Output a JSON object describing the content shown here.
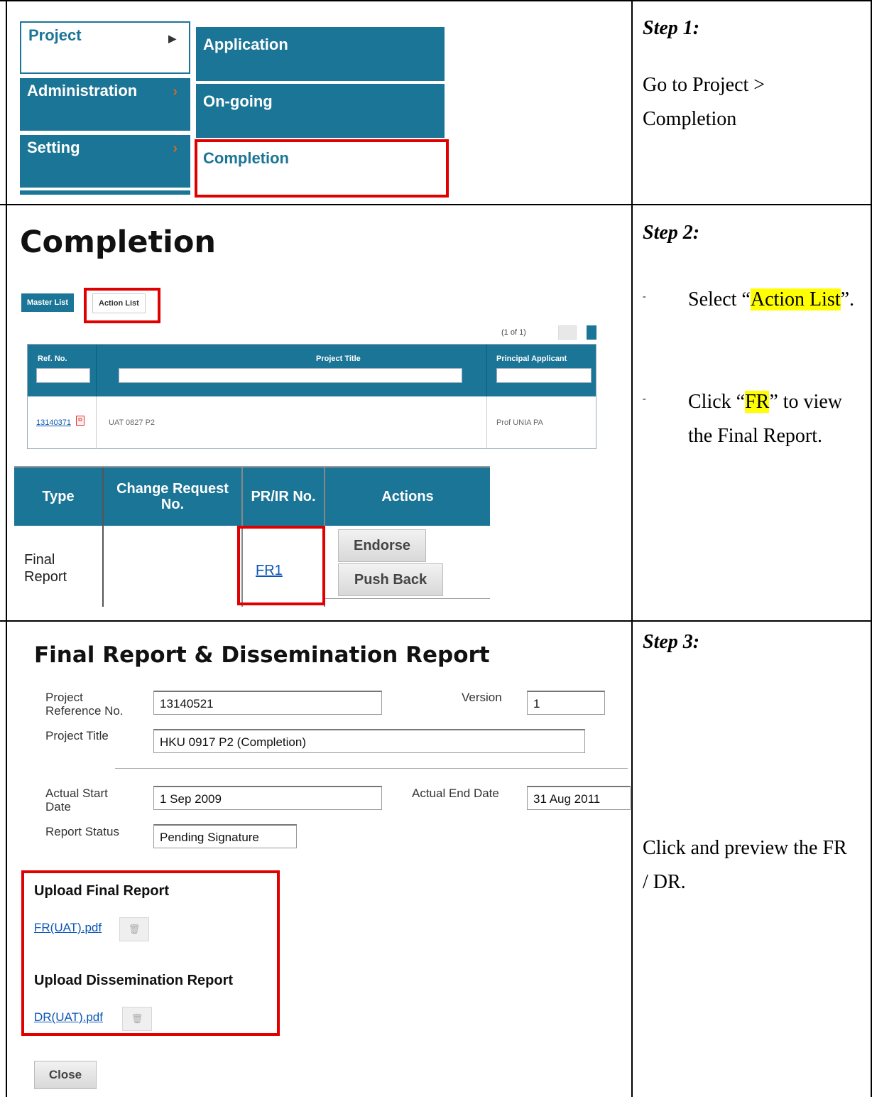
{
  "section1": {
    "menu": [
      {
        "label": "Project",
        "arrow": "▶"
      },
      {
        "label": "Administration",
        "arrow": "›"
      },
      {
        "label": "Setting",
        "arrow": "›"
      }
    ],
    "submenu": [
      "Application",
      "On-going",
      "Completion"
    ],
    "step_title": "Step 1:",
    "instruction": "Go to Project > Completion"
  },
  "section2": {
    "page_title": "Completion",
    "tabs": {
      "master": "Master List",
      "action": "Action List"
    },
    "pagination": "(1 of 1)",
    "list_headers": [
      "Ref. No.",
      "Project Title",
      "Principal Applicant"
    ],
    "list_row": {
      "ref": "13140371",
      "title": "UAT 0827 P2",
      "applicant": "Prof UNIA PA"
    },
    "action_headers": [
      "Type",
      "Change Request No.",
      "PR/IR No.",
      "Actions"
    ],
    "action_row": {
      "type": "Final Report",
      "change_request": "",
      "pr_ir": "FR1"
    },
    "buttons": {
      "endorse": "Endorse",
      "push_back": "Push Back"
    },
    "step_title": "Step 2:",
    "bullet1": {
      "prefix": "Select “",
      "highlight": "Action List",
      "suffix": "”."
    },
    "bullet2": {
      "prefix": "Click “",
      "highlight": "FR",
      "suffix": "” to view the Final Report."
    },
    "bullet_marker": "-"
  },
  "section3": {
    "page_title": "Final Report & Dissemination Report",
    "labels": {
      "ref": "Project Reference No.",
      "version": "Version",
      "title": "Project Title",
      "start": "Actual Start Date",
      "end": "Actual End Date",
      "status": "Report Status"
    },
    "values": {
      "ref": "13140521",
      "version": "1",
      "title": "HKU 0917 P2 (Completion)",
      "start": "1 Sep 2009",
      "end": "31 Aug 2011",
      "status": "Pending Signature"
    },
    "upload_final": "Upload Final Report",
    "final_file": "FR(UAT).pdf",
    "upload_dissemination": "Upload Dissemination Report",
    "dissemination_file": "DR(UAT).pdf",
    "close": "Close",
    "step_title": "Step 3:",
    "instruction": "Click and preview the FR / DR."
  },
  "colors": {
    "accent": "#1b7596",
    "highlight_box": "#e00000",
    "text_highlight": "#ffff00"
  }
}
